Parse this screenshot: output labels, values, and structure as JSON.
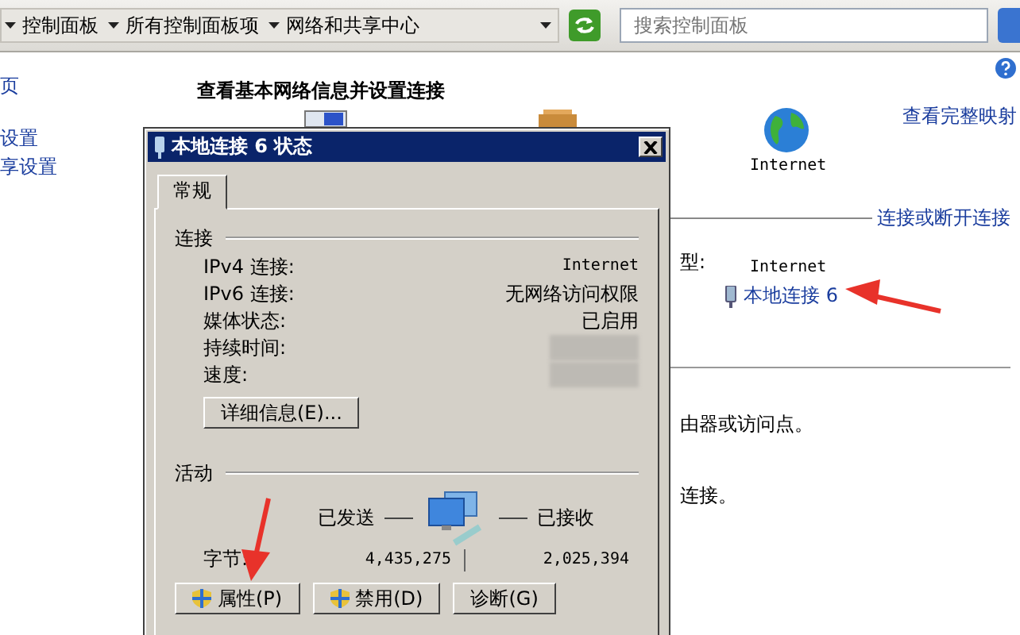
{
  "address_bar": {
    "breadcrumbs": [
      "控制面板",
      "所有控制面板项",
      "网络和共享中心"
    ],
    "search": {
      "placeholder": "搜索控制面板"
    }
  },
  "sidebar": {
    "items": [
      "页",
      "设置",
      "享设置"
    ]
  },
  "main": {
    "title": "查看基本网络信息并设置连接",
    "internet_label": "Internet",
    "view_full_map": "查看完整映射",
    "connect_link": "连接或断开连接",
    "type_label": "型:",
    "type_value": "Internet",
    "connection_link": "本地连接 6",
    "text_lines": [
      "由器或访问点。",
      "连接。"
    ]
  },
  "dialog": {
    "title": "本地连接 6 状态",
    "tabs": [
      {
        "label": "常规",
        "selected": true
      }
    ],
    "connection_group": "连接",
    "rows": [
      {
        "label": "IPv4 连接:",
        "value": "Internet"
      },
      {
        "label": "IPv6 连接:",
        "value": "无网络访问权限"
      },
      {
        "label": "媒体状态:",
        "value": "已启用"
      },
      {
        "label": "持续时间:"
      },
      {
        "label": "速度:"
      }
    ],
    "details_button": "详细信息(E)...",
    "activity_group": "活动",
    "sent_label": "已发送",
    "received_label": "已接收",
    "bytes_label": "字节:",
    "bytes_sent": "4,435,275",
    "bytes_received": "2,025,394",
    "buttons": [
      {
        "label": "属性(P)",
        "kind": "shield"
      },
      {
        "label": "禁用(D)",
        "kind": "shield"
      },
      {
        "label": "诊断(G)",
        "kind": "plain"
      }
    ]
  }
}
